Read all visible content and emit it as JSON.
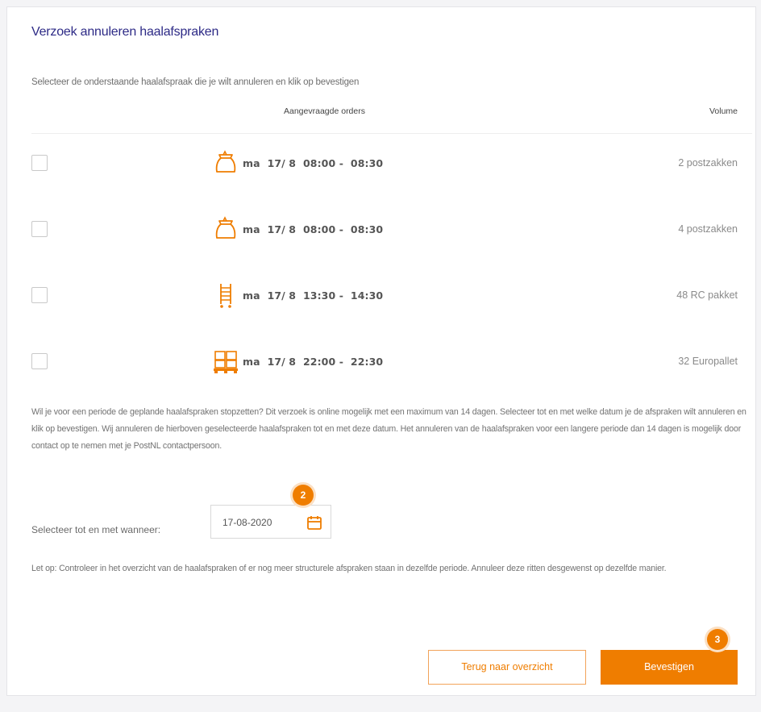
{
  "title": "Verzoek annuleren haalafspraken",
  "intro": "Selecteer de onderstaande haalafspraak die je wilt annuleren en klik op bevestigen",
  "table": {
    "headers": {
      "orders": "Aangevraagde orders",
      "volume": "Volume"
    },
    "rows": [
      {
        "icon": "mail-bag-icon",
        "order": "ma  17/ 8  08:00 -  08:30",
        "volume": "2 postzakken"
      },
      {
        "icon": "mail-bag-icon",
        "order": "ma  17/ 8  08:00 -  08:30",
        "volume": "4 postzakken"
      },
      {
        "icon": "roll-container-icon",
        "order": "ma  17/ 8  13:30 -  14:30",
        "volume": "48 RC pakket"
      },
      {
        "icon": "euro-pallet-icon",
        "order": "ma  17/ 8  22:00 -  22:30",
        "volume": "32 Europallet"
      }
    ]
  },
  "period_text": "Wil je voor een periode de geplande haalafspraken stopzetten? Dit verzoek is online mogelijk met een maximum van 14 dagen. Selecteer tot en met welke datum je de afspraken wilt annuleren en klik op bevestigen. Wij annuleren de hierboven geselecteerde haalafspraken tot en met deze datum. Het annuleren van de haalafspraken voor een langere periode dan 14 dagen is mogelijk door contact op te nemen met je PostNL contactpersoon.",
  "date": {
    "label": "Selecteer tot en met wanneer:",
    "value": "17-08-2020",
    "icon": "calendar-icon"
  },
  "note_text": "Let op: Controleer in het overzicht van de haalafspraken of er nog meer structurele afspraken staan in dezelfde periode. Annuleer deze ritten desgewenst op dezelfde manier.",
  "buttons": {
    "back": "Terug naar overzicht",
    "confirm": "Bevestigen"
  },
  "badges": {
    "date": "2",
    "confirm": "3"
  },
  "colors": {
    "accent": "#ef7d00",
    "title": "#2d2a86",
    "badge_ring": "#fbe0c4"
  }
}
